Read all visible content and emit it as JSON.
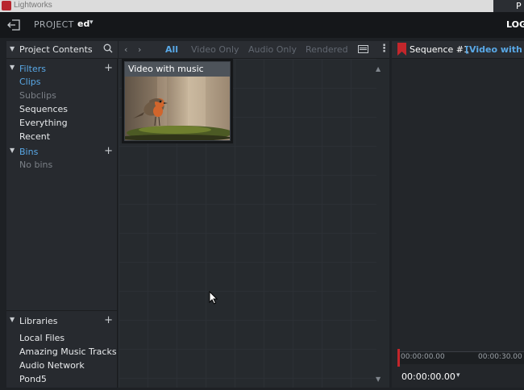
{
  "os": {
    "window_title": "Lightworks",
    "corner_letter": "P"
  },
  "topbar": {
    "project_label": "PROJECT",
    "project_name": "ed",
    "logout_label": "LOG"
  },
  "sidebar": {
    "project_contents_label": "Project Contents",
    "filters_label": "Filters",
    "filters": [
      {
        "label": "Clips",
        "active": true
      },
      {
        "label": "Subclips",
        "active": false
      },
      {
        "label": "Sequences",
        "active": false
      },
      {
        "label": "Everything",
        "active": false
      },
      {
        "label": "Recent",
        "active": false
      }
    ],
    "bins_label": "Bins",
    "no_bins_label": "No bins",
    "libraries_label": "Libraries",
    "libraries": [
      {
        "label": "Local Files"
      },
      {
        "label": "Amazing Music Tracks"
      },
      {
        "label": "Audio Network"
      },
      {
        "label": "Pond5"
      }
    ]
  },
  "browser": {
    "tabs": [
      {
        "label": "All",
        "active": true
      },
      {
        "label": "Video Only",
        "active": false
      },
      {
        "label": "Audio Only",
        "active": false
      },
      {
        "label": "Rendered",
        "active": false
      }
    ],
    "clips": [
      {
        "title": "Video with music"
      }
    ]
  },
  "sequence": {
    "title": "Sequence #1",
    "clip_name": "[Video with mus",
    "ruler": [
      "00:00:00.00",
      "00:00:30.00"
    ],
    "timecode": "00:00:00.00"
  },
  "colors": {
    "accent": "#59a8e6",
    "marker": "#c3262b"
  }
}
